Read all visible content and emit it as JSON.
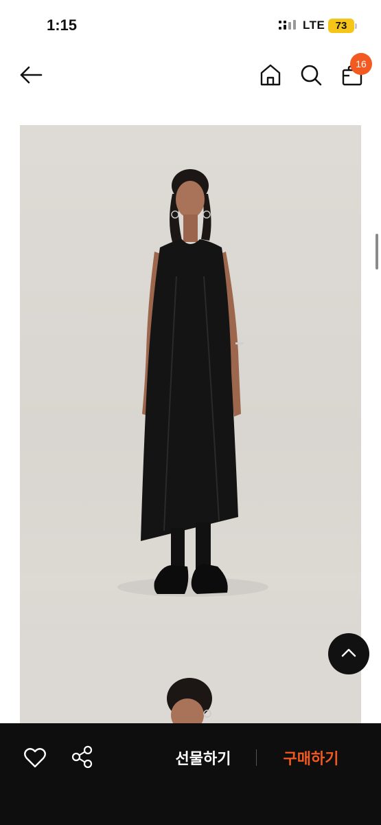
{
  "status_bar": {
    "time": "1:15",
    "network": "LTE",
    "battery": "73",
    "battery_color": "#f5c518"
  },
  "nav": {
    "back_icon": "arrow-left",
    "home_icon": "home",
    "search_icon": "search",
    "shop_icon": "shopping-bag",
    "cart_count": "16",
    "badge_color": "#f25a21"
  },
  "product_images": {
    "image_1_description": "",
    "count_visible": 2
  },
  "bottom_bar": {
    "gift_label": "선물하기",
    "buy_label": "구매하기",
    "buy_color": "#f2591f",
    "background": "#0e0e0e"
  }
}
